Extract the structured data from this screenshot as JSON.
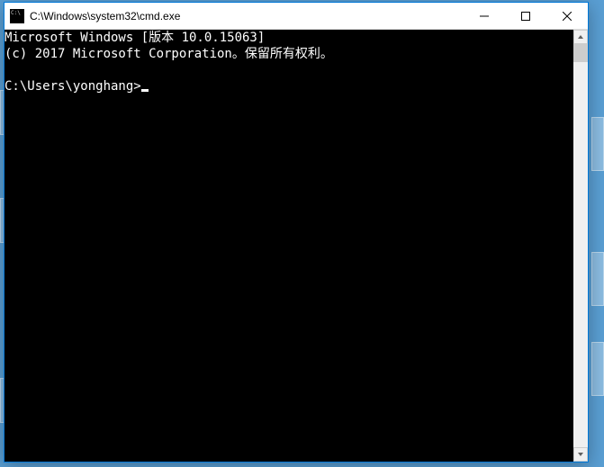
{
  "window": {
    "title": "C:\\Windows\\system32\\cmd.exe"
  },
  "console": {
    "line1": "Microsoft Windows [版本 10.0.15063]",
    "line2": "(c) 2017 Microsoft Corporation。保留所有权利。",
    "blank": "",
    "prompt": "C:\\Users\\yonghang>"
  }
}
